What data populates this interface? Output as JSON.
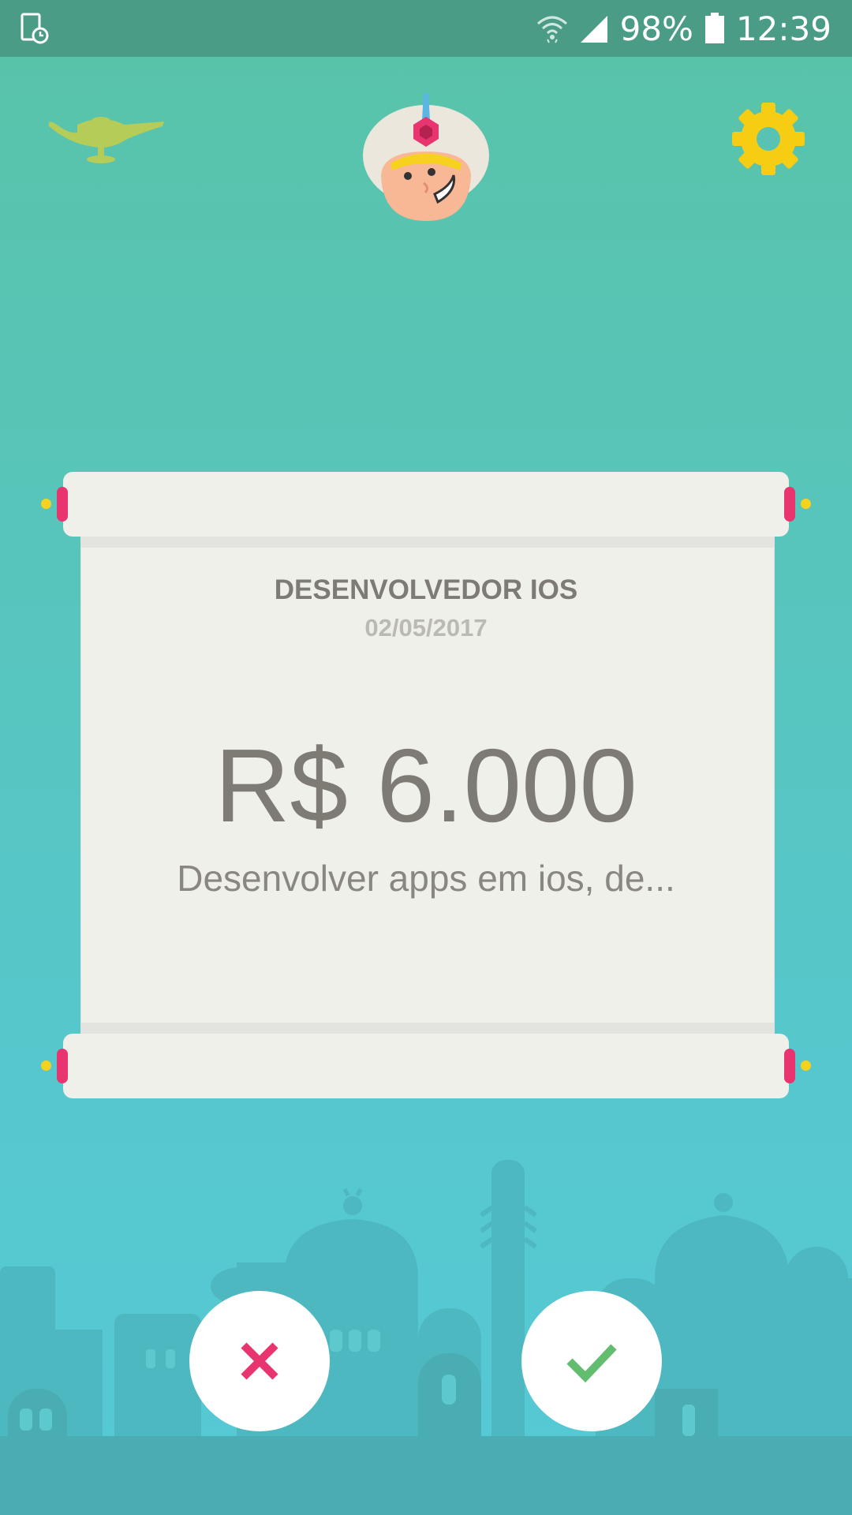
{
  "status_bar": {
    "battery": "98%",
    "time": "12:39",
    "icons": [
      "screenshot-icon",
      "wifi-icon",
      "signal-icon",
      "battery-icon"
    ]
  },
  "header": {
    "icons": [
      "lamp-icon",
      "genie-avatar",
      "settings-gear-icon"
    ]
  },
  "card": {
    "title": "DESENVOLVEDOR IOS",
    "date": "02/05/2017",
    "salary": "R$ 6.000",
    "description": "Desenvolver apps em ios, de..."
  },
  "actions": {
    "reject_icon": "close-icon",
    "accept_icon": "check-icon"
  },
  "colors": {
    "status_bar": "#4a9c86",
    "background_top": "#59c3a8",
    "background_bottom": "#55c9d6",
    "gear": "#f6cd13",
    "lamp": "#b5cc58",
    "card": "#eff0ea",
    "reject": "#e8356f",
    "accept": "#63bd6e"
  }
}
